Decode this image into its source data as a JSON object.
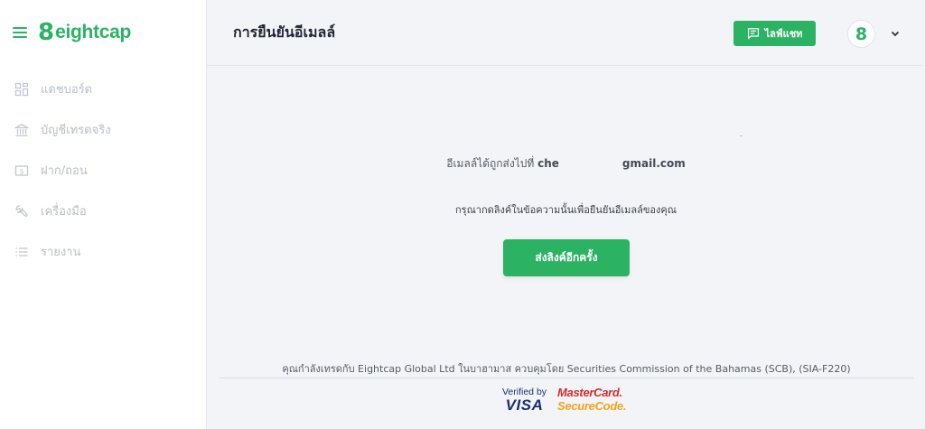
{
  "brand": {
    "logo_mark": "8",
    "logo_text": "eightcap",
    "color": "#2bb363"
  },
  "sidebar": {
    "items": [
      {
        "label": "แดชบอร์ด",
        "icon": "dashboard-grid-icon"
      },
      {
        "label": "บัญชีเทรดจริง",
        "icon": "bank-icon"
      },
      {
        "label": "ฝาก/ถอน",
        "icon": "money-icon"
      },
      {
        "label": "เครื่องมือ",
        "icon": "wrench-icon"
      },
      {
        "label": "รายงาน",
        "icon": "list-icon"
      }
    ]
  },
  "header": {
    "title": "การยืนยันอีเมลล์",
    "live_chat_label": "ไลฟ์แชท",
    "avatar_initial": "8"
  },
  "main": {
    "email_prefix": "อีเมลล์ได้ถูกส่งไปที่",
    "email_start": "che",
    "email_end": "gmail.com",
    "instruction": "กรุณากดลิงค์ในข้อความนั้นเพื่อยืนยันอีเมลล์ของคุณ",
    "resend_label": "ส่งลิงค์อีกครั้ง",
    "dot": "."
  },
  "footer": {
    "regulatory_text": "คุณกำลังเทรดกับ Eightcap Global Ltd ในบาฮามาส ควบคุมโดย Securities Commission of the Bahamas (SCB), (SIA-F220)",
    "visa_line1": "Verified by",
    "visa_line2": "VISA",
    "mastercard_line1": "MasterCard.",
    "mastercard_line2": "SecureCode."
  }
}
